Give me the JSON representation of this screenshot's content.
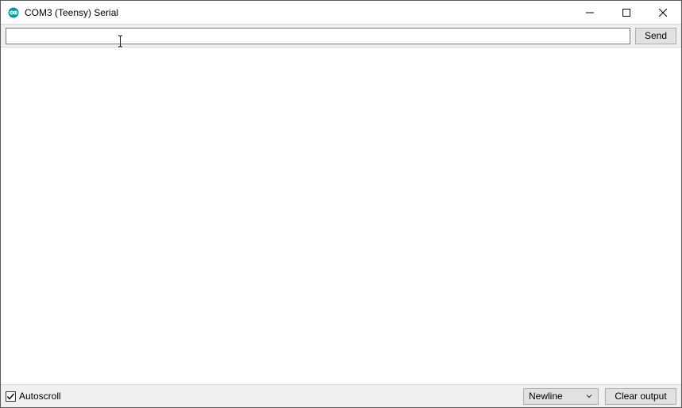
{
  "window": {
    "title": "COM3 (Teensy) Serial"
  },
  "top": {
    "input_value": "",
    "input_placeholder": "",
    "send_label": "Send"
  },
  "output": {
    "text": ""
  },
  "bottom": {
    "autoscroll_label": "Autoscroll",
    "autoscroll_checked": true,
    "line_ending_selected": "Newline",
    "clear_label": "Clear output"
  }
}
